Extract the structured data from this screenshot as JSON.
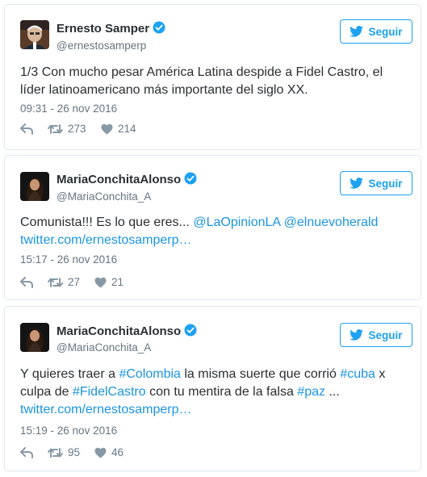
{
  "colors": {
    "accent": "#1da1f2",
    "link": "#1b95e0",
    "meta": "#66757f",
    "border": "#e1e8ed"
  },
  "tweets": [
    {
      "author": {
        "name": "Ernesto Samper",
        "handle": "@ernestosamperp",
        "verified": true
      },
      "follow_label": "Seguir",
      "segments": [
        {
          "text": "1/3 Con mucho pesar América Latina despide a Fidel Castro, el líder latinoamericano más importante del siglo XX.",
          "link": false
        }
      ],
      "timestamp": "09:31 - 26 nov 2016",
      "retweets": "273",
      "likes": "214"
    },
    {
      "author": {
        "name": "MariaConchitaAlonso",
        "handle": "@MariaConchita_A",
        "verified": true
      },
      "follow_label": "Seguir",
      "segments": [
        {
          "text": "Comunista!!! Es lo que eres... ",
          "link": false
        },
        {
          "text": "@LaOpinionLA",
          "link": true
        },
        {
          "text": " ",
          "link": false
        },
        {
          "text": "@elnuevoherald",
          "link": true
        },
        {
          "text": " ",
          "link": false
        },
        {
          "text": "twitter.com/ernestosamperp…",
          "link": true
        }
      ],
      "timestamp": "15:17 - 26 nov 2016",
      "retweets": "27",
      "likes": "21"
    },
    {
      "author": {
        "name": "MariaConchitaAlonso",
        "handle": "@MariaConchita_A",
        "verified": true
      },
      "follow_label": "Seguir",
      "segments": [
        {
          "text": "Y quieres traer a ",
          "link": false
        },
        {
          "text": "#Colombia",
          "link": true
        },
        {
          "text": " la misma suerte que corrió ",
          "link": false
        },
        {
          "text": "#cuba",
          "link": true
        },
        {
          "text": " x culpa de ",
          "link": false
        },
        {
          "text": "#FidelCastro",
          "link": true
        },
        {
          "text": " con tu mentira de la falsa ",
          "link": false
        },
        {
          "text": "#paz",
          "link": true
        },
        {
          "text": " ... ",
          "link": false
        },
        {
          "text": "twitter.com/ernestosamperp…",
          "link": true
        }
      ],
      "timestamp": "15:19 - 26 nov 2016",
      "retweets": "95",
      "likes": "46"
    }
  ]
}
